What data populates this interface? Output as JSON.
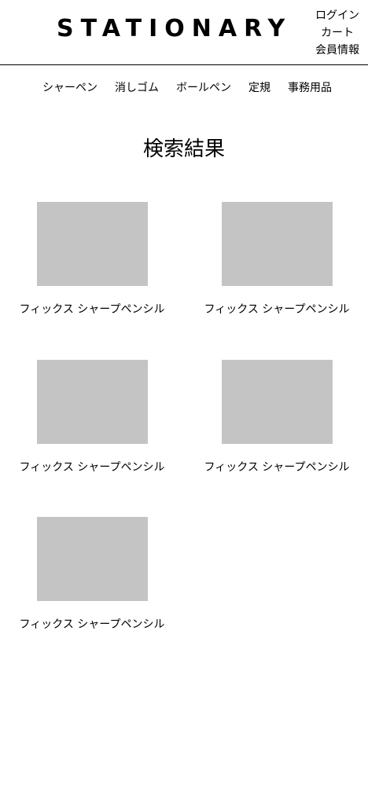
{
  "header": {
    "logo": "STATIONARY",
    "links": {
      "login": "ログイン",
      "cart": "カート",
      "member": "会員情報"
    }
  },
  "nav": {
    "items": [
      {
        "label": "シャーペン"
      },
      {
        "label": "消しゴム"
      },
      {
        "label": "ボールペン"
      },
      {
        "label": "定規"
      },
      {
        "label": "事務用品"
      }
    ]
  },
  "main": {
    "title": "検索結果",
    "products": [
      {
        "name": "フィックス シャープペンシル"
      },
      {
        "name": "フィックス シャープペンシル"
      },
      {
        "name": "フィックス シャープペンシル"
      },
      {
        "name": "フィックス シャープペンシル"
      },
      {
        "name": "フィックス シャープペンシル"
      }
    ]
  },
  "colors": {
    "thumbnail_placeholder": "#c4c4c4",
    "text": "#000000",
    "background": "#ffffff"
  }
}
